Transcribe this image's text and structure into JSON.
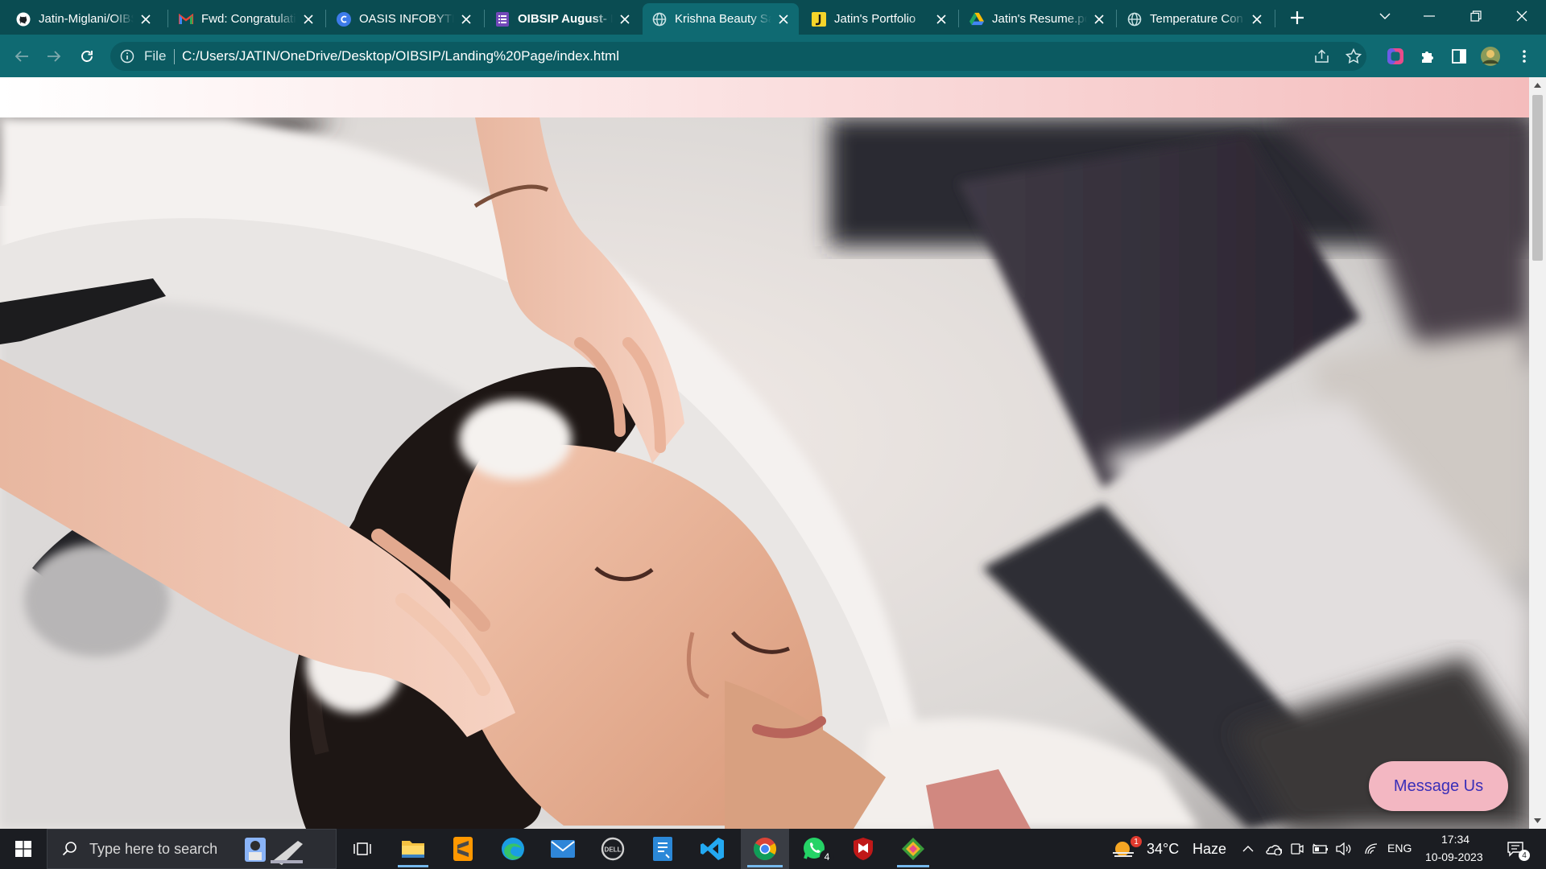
{
  "browser": {
    "tabs": [
      {
        "title": "Jatin-Miglani/OIBSIP",
        "icon": "github-icon",
        "bold": false
      },
      {
        "title": "Fwd: Congratulations",
        "icon": "gmail-icon",
        "bold": false
      },
      {
        "title": "OASIS INFOBYTE",
        "icon": "canva-icon",
        "bold": false
      },
      {
        "title": "OIBSIP August- P",
        "icon": "forms-icon",
        "bold": true
      },
      {
        "title": "Krishna Beauty Salon",
        "icon": "globe-icon",
        "bold": false,
        "active": true
      },
      {
        "title": "Jatin's Portfolio",
        "icon": "portfolio-icon",
        "bold": false
      },
      {
        "title": "Jatin's Resume.pdf",
        "icon": "drive-icon",
        "bold": false
      },
      {
        "title": "Temperature Con",
        "icon": "globe-icon",
        "bold": false
      }
    ],
    "omnibox": {
      "scheme_label": "File",
      "url": "C:/Users/JATIN/OneDrive/Desktop/OIBSIP/Landing%20Page/index.html"
    }
  },
  "page": {
    "hero_image": "woman receiving hair wash at salon",
    "message_button": "Message Us"
  },
  "taskbar": {
    "search_placeholder": "Type here to search",
    "weather": {
      "temp": "34°C",
      "condition": "Haze",
      "alert_count": "1"
    },
    "language": "ENG",
    "time": "17:34",
    "date": "10-09-2023",
    "whatsapp_badge": "4",
    "notification_count": "4"
  },
  "colors": {
    "tab_strip": "#0a4c52",
    "toolbar": "#0f6a72",
    "navbar_gradient_end": "#f4bcbc",
    "message_button_bg": "#f3b7c2",
    "message_button_text": "#3a2fb8"
  }
}
